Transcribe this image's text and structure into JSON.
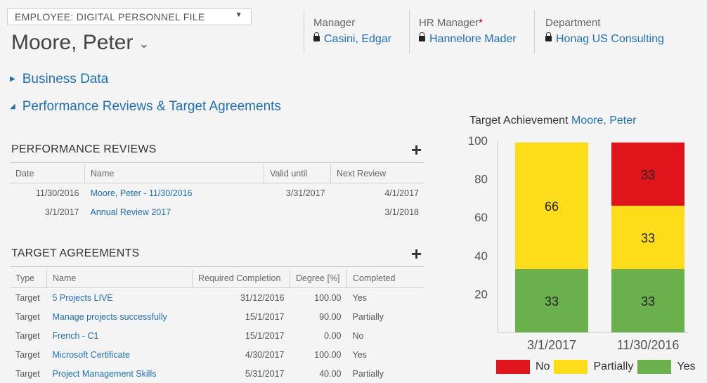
{
  "form_selector": "EMPLOYEE: DIGITAL PERSONNEL FILE",
  "record_name": "Moore, Peter",
  "header_fields": [
    {
      "label": "Manager",
      "value": "Casini, Edgar",
      "required": false
    },
    {
      "label": "HR Manager",
      "value": "Hannelore Mader",
      "required": true
    },
    {
      "label": "Department",
      "value": "Honag US Consulting",
      "required": false
    }
  ],
  "sections": {
    "business_data": "Business Data",
    "performance": "Performance Reviews & Target Agreements"
  },
  "performance_reviews": {
    "title": "PERFORMANCE REVIEWS",
    "columns": [
      "Date",
      "Name",
      "Valid until",
      "Next Review"
    ],
    "rows": [
      {
        "date": "11/30/2016",
        "name": "Moore, Peter - 11/30/2016",
        "valid_until": "3/31/2017",
        "next_review": "4/1/2017"
      },
      {
        "date": "3/1/2017",
        "name": "Annual Review 2017",
        "valid_until": "",
        "next_review": "3/1/2018"
      }
    ]
  },
  "target_agreements": {
    "title": "TARGET AGREEMENTS",
    "columns": [
      "Type",
      "Name",
      "Required Completion",
      "Degree [%]",
      "Completed"
    ],
    "rows": [
      {
        "type": "Target",
        "name": "5 Projects LIVE",
        "required": "31/12/2016",
        "degree": "100.00",
        "completed": "Yes"
      },
      {
        "type": "Target",
        "name": "Manage projects successfully",
        "required": "15/1/2017",
        "degree": "90.00",
        "completed": "Partially"
      },
      {
        "type": "Target",
        "name": "French - C1",
        "required": "15/1/2017",
        "degree": "0.00",
        "completed": "No"
      },
      {
        "type": "Target",
        "name": "Microsoft Certificate",
        "required": "4/30/2017",
        "degree": "100.00",
        "completed": "Yes"
      },
      {
        "type": "Target",
        "name": "Project Management Skills",
        "required": "5/31/2017",
        "degree": "40.00",
        "completed": "Partially"
      }
    ]
  },
  "chart_title": {
    "prefix": "Target Achievement",
    "name": "Moore, Peter"
  },
  "chart_data": {
    "type": "bar",
    "stacked": true,
    "categories": [
      "3/1/2017",
      "11/30/2016"
    ],
    "series": [
      {
        "name": "Yes",
        "color": "#6ab04c",
        "values": [
          33,
          33
        ]
      },
      {
        "name": "Partially",
        "color": "#fddc1a",
        "values": [
          66,
          33
        ]
      },
      {
        "name": "No",
        "color": "#e0141b",
        "values": [
          0,
          33
        ]
      }
    ],
    "yticks": [
      "20",
      "40",
      "60",
      "80",
      "100"
    ],
    "ylim": [
      0,
      100
    ],
    "legend": "bottom"
  }
}
